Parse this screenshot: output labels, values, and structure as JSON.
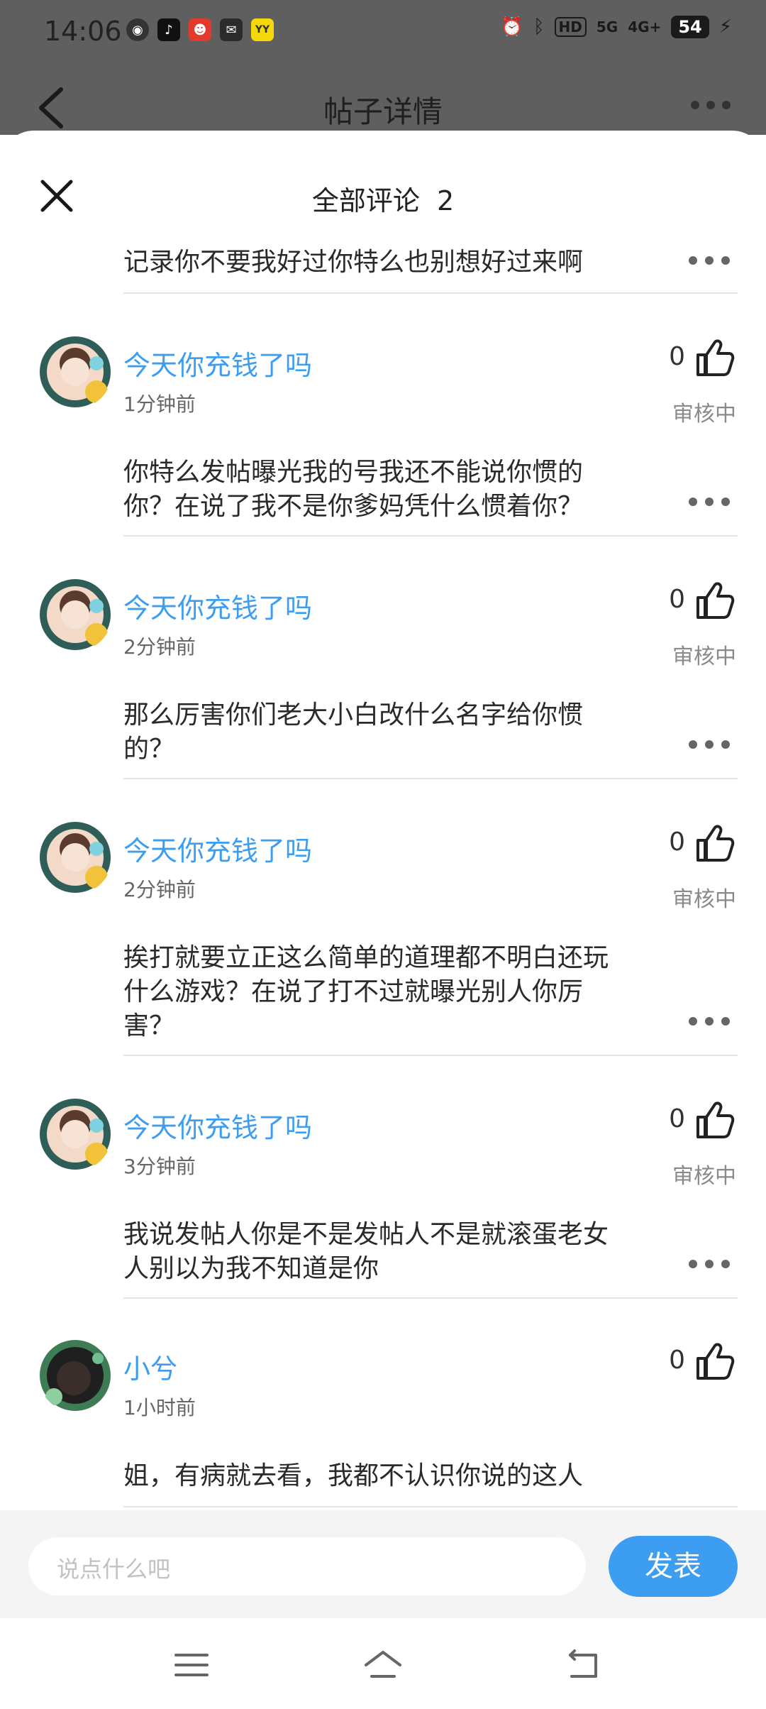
{
  "status_bar": {
    "time": "14:06",
    "network_hd": "HD",
    "network_5g": "5G",
    "network_4g": "4G+",
    "battery": "54"
  },
  "header": {
    "title": "帖子详情"
  },
  "sheet": {
    "title": "全部评论  2"
  },
  "first_comment_text": "记录你不要我好过你特么也别想好过来啊",
  "comments": [
    {
      "username": "今天你充钱了吗",
      "time": "1分钟前",
      "likes": "0",
      "status": "审核中",
      "lines": [
        "你特么发帖曝光我的号我还不能说你惯的",
        "你？在说了我不是你爹妈凭什么惯着你？"
      ]
    },
    {
      "username": "今天你充钱了吗",
      "time": "2分钟前",
      "likes": "0",
      "status": "审核中",
      "lines": [
        "那么厉害你们老大小白改什么名字给你惯",
        "的？"
      ]
    },
    {
      "username": "今天你充钱了吗",
      "time": "2分钟前",
      "likes": "0",
      "status": "审核中",
      "lines": [
        "挨打就要立正这么简单的道理都不明白还玩",
        "什么游戏？在说了打不过就曝光别人你厉",
        "害？"
      ]
    },
    {
      "username": "今天你充钱了吗",
      "time": "3分钟前",
      "likes": "0",
      "status": "审核中",
      "lines": [
        "我说发帖人你是不是发帖人不是就滚蛋老女",
        "人别以为我不知道是你"
      ]
    },
    {
      "username": "小兮",
      "time": "1小时前",
      "likes": "0",
      "lines": [
        "姐，有病就去看，我都不认识你说的这人"
      ]
    }
  ],
  "input": {
    "placeholder": "说点什么吧",
    "send_label": "发表"
  },
  "colors": {
    "accent": "#3d9df0",
    "overlay": "#5f5f5f"
  }
}
